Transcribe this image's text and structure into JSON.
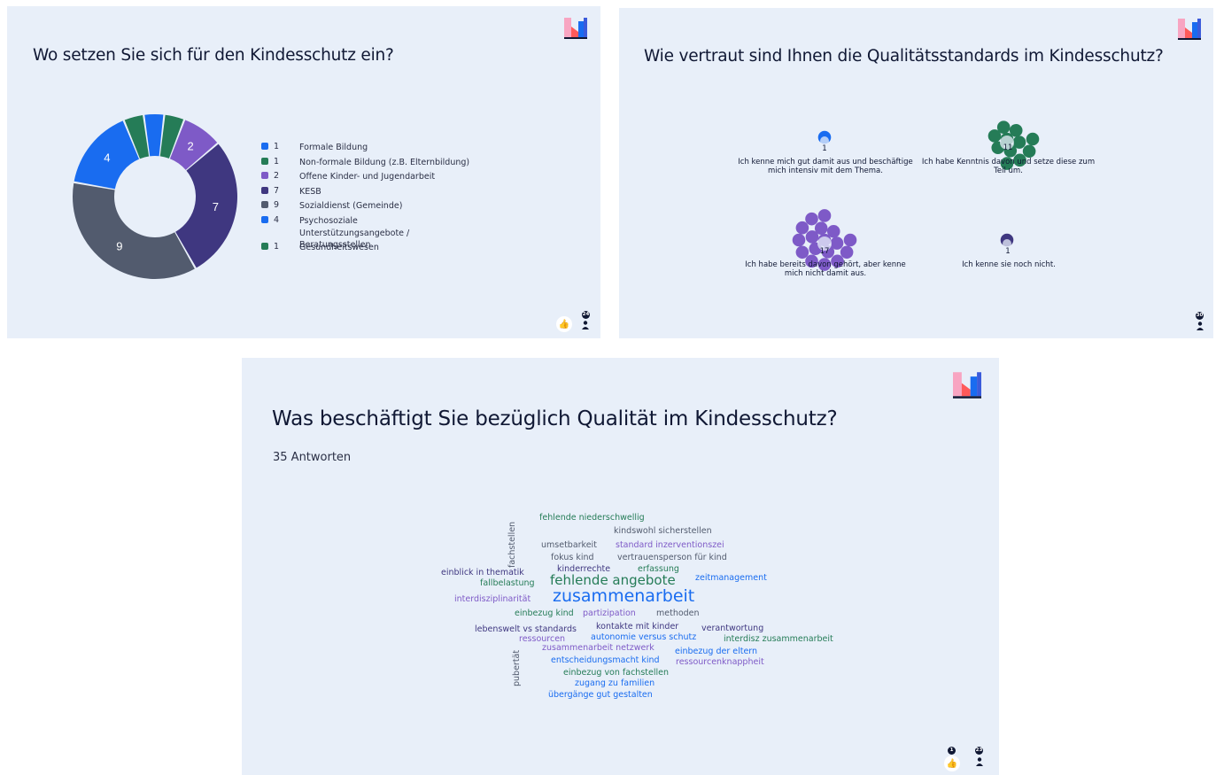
{
  "slide1": {
    "title": "Wo setzen Sie sich für den Kindesschutz ein?",
    "chart_data": {
      "type": "pie",
      "categories": [
        "Formale Bildung",
        "Non-formale Bildung (z.B. Elternbildung)",
        "Offene Kinder- und Jugendarbeit",
        "KESB",
        "Sozialdienst (Gemeinde)",
        "Psychosoziale Unterstützungsangebote / Beratungsstellen",
        "Gesundheitswesen"
      ],
      "values": [
        1,
        1,
        2,
        7,
        9,
        4,
        1
      ],
      "colors": [
        "#196cf0",
        "#257c57",
        "#7e5ac7",
        "#3f3780",
        "#525b6e",
        "#196cf0",
        "#257c57"
      ]
    },
    "legend": [
      {
        "num": "1",
        "label": "Formale Bildung",
        "color": "#196cf0"
      },
      {
        "num": "1",
        "label": "Non-formale Bildung (z.B. Elternbildung)",
        "color": "#257c57"
      },
      {
        "num": "2",
        "label": "Offene Kinder- und Jugendarbeit",
        "color": "#7e5ac7"
      },
      {
        "num": "7",
        "label": "KESB",
        "color": "#3f3780"
      },
      {
        "num": "9",
        "label": "Sozialdienst (Gemeinde)",
        "color": "#525b6e"
      },
      {
        "num": "4",
        "label": "Psychosoziale Unterstützungsangebote / Beratungsstellen",
        "color": "#196cf0"
      },
      {
        "num": "1",
        "label": "Gesundheitswesen",
        "color": "#257c57"
      }
    ],
    "participants": "24"
  },
  "slide2": {
    "title": "Wie vertraut sind Ihnen die Qualitätsstandards im Kindesschutz?",
    "chart_data": {
      "type": "scatter",
      "categories": [
        "Ich kenne mich gut damit aus und beschäftige mich intensiv mit dem Thema.",
        "Ich habe Kenntnis davon und setze diese zum Teil um.",
        "Ich habe bereits davon gehört, aber kenne mich nicht damit aus.",
        "Ich kenne sie noch nicht."
      ],
      "values": [
        1,
        11,
        17,
        1
      ],
      "colors": [
        "#196cf0",
        "#257c57",
        "#7e5ac7",
        "#3f3780"
      ]
    },
    "counts": [
      "1",
      "11",
      "17",
      "1"
    ],
    "captions": [
      "Ich kenne mich gut damit aus und beschäftige mich intensiv mit dem Thema.",
      "Ich habe Kenntnis davon und setze diese zum Teil um.",
      "Ich habe bereits davon gehört, aber kenne mich nicht damit aus.",
      "Ich kenne sie noch nicht."
    ],
    "participants": "30"
  },
  "slide3": {
    "title": "Was beschäftigt Sie bezüglich Qualität im Kindesschutz?",
    "subtitle": "35 Antworten",
    "words": [
      {
        "text": "fehlende niederschwellig",
        "color": "#257c57"
      },
      {
        "text": "kindswohl sicherstellen",
        "color": "#525b6e"
      },
      {
        "text": "umsetbarkeit",
        "color": "#525b6e"
      },
      {
        "text": "standard inzerventionszei",
        "color": "#7e5ac7"
      },
      {
        "text": "fokus kind",
        "color": "#525b6e"
      },
      {
        "text": "vertrauensperson für kind",
        "color": "#525b6e"
      },
      {
        "text": "kinderrechte",
        "color": "#3f3780"
      },
      {
        "text": "erfassung",
        "color": "#257c57"
      },
      {
        "text": "einblick in thematik",
        "color": "#3f3780"
      },
      {
        "text": "fallbelastung",
        "color": "#257c57"
      },
      {
        "text": "fehlende angebote",
        "color": "#257c57"
      },
      {
        "text": "zeitmanagement",
        "color": "#196cf0"
      },
      {
        "text": "interdisziplinarität",
        "color": "#7e5ac7"
      },
      {
        "text": "zusammenarbeit",
        "color": "#196cf0"
      },
      {
        "text": "einbezug kind",
        "color": "#257c57"
      },
      {
        "text": "partizipation",
        "color": "#7e5ac7"
      },
      {
        "text": "methoden",
        "color": "#525b6e"
      },
      {
        "text": "lebenswelt vs standards",
        "color": "#3f3780"
      },
      {
        "text": "kontakte mit kinder",
        "color": "#3f3780"
      },
      {
        "text": "verantwortung",
        "color": "#3f3780"
      },
      {
        "text": "ressourcen",
        "color": "#7e5ac7"
      },
      {
        "text": "autonomie versus schutz",
        "color": "#196cf0"
      },
      {
        "text": "interdisz zusammenarbeit",
        "color": "#257c57"
      },
      {
        "text": "zusammenarbeit netzwerk",
        "color": "#7e5ac7"
      },
      {
        "text": "einbezug der eltern",
        "color": "#196cf0"
      },
      {
        "text": "entscheidungsmacht kind",
        "color": "#196cf0"
      },
      {
        "text": "ressourcenknappheit",
        "color": "#7e5ac7"
      },
      {
        "text": "einbezug von fachstellen",
        "color": "#257c57"
      },
      {
        "text": "zugang zu familien",
        "color": "#196cf0"
      },
      {
        "text": "übergänge gut gestalten",
        "color": "#196cf0"
      },
      {
        "text": "fachstellen",
        "color": "#525b6e"
      },
      {
        "text": "pubertät",
        "color": "#525b6e"
      }
    ],
    "likes": "1",
    "participants": "23"
  },
  "icons": {
    "logo": "mentimeter-logo-icon",
    "like": "thumbs-up-icon",
    "person": "person-icon"
  }
}
